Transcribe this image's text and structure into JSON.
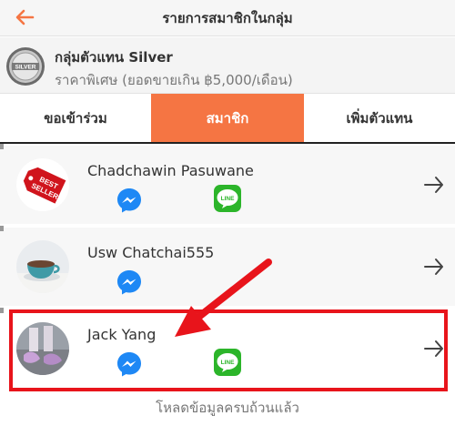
{
  "header": {
    "title": "รายการสมาชิกในกลุ่ม",
    "back_icon": "arrow-left-icon",
    "accent": "#f57543"
  },
  "group": {
    "logo_text": "SILVER",
    "name": "กลุ่มตัวแทน Silver",
    "description": "ราคาพิเศษ (ยอดขายเกิน ฿5,000/เดือน)"
  },
  "tabs": [
    {
      "label": "ขอเข้าร่วม",
      "active": false
    },
    {
      "label": "สมาชิก",
      "active": true
    },
    {
      "label": "เพิ่มตัวแทน",
      "active": false
    }
  ],
  "members": [
    {
      "name": "Chadchawin Pasuwane",
      "avatar": "best-seller-tag",
      "has_line": true
    },
    {
      "name": "Usw Chatchai555",
      "avatar": "coffee-cup",
      "has_line": false
    },
    {
      "name": "Jack Yang",
      "avatar": "shoes-photo",
      "has_line": true
    }
  ],
  "footer": {
    "text": "โหลดข้อมูลครบถ้วนแล้ว"
  },
  "annotation": {
    "color": "#e8141b"
  }
}
